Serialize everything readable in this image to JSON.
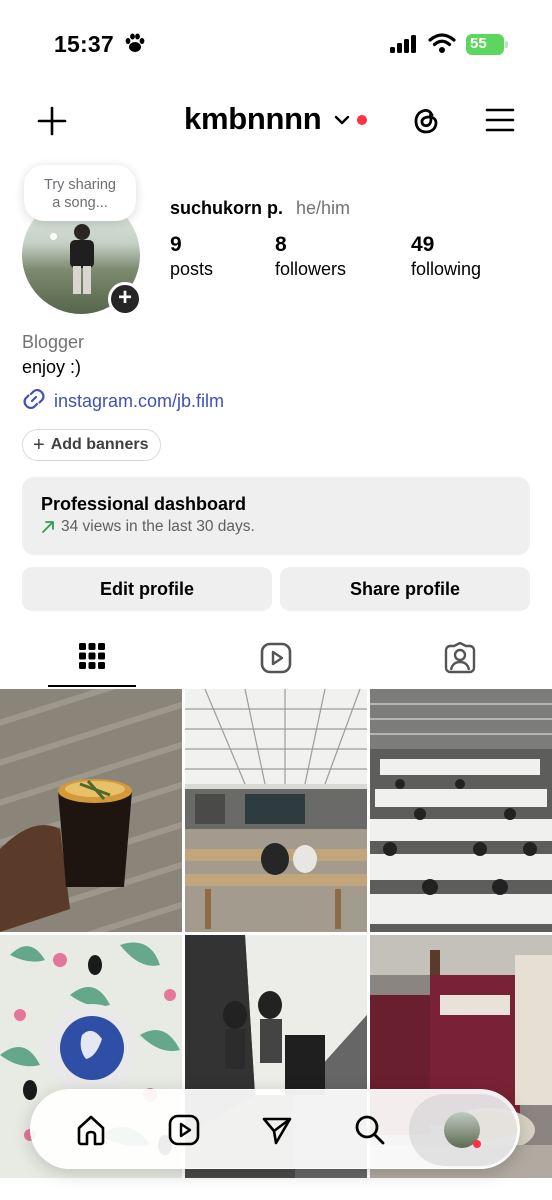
{
  "status_bar": {
    "time": "15:37",
    "battery": "55"
  },
  "header": {
    "username": "kmbnnnn"
  },
  "profile": {
    "bubble_text_line1": "Try sharing",
    "bubble_text_line2": "a song...",
    "name": "suchukorn p.",
    "pronouns": "he/him",
    "stats": [
      {
        "value": "9",
        "label": "posts"
      },
      {
        "value": "8",
        "label": "followers"
      },
      {
        "value": "49",
        "label": "following"
      }
    ],
    "category": "Blogger",
    "bio": "enjoy :)",
    "link": "instagram.com/jb.film",
    "add_banners": "Add banners"
  },
  "dashboard": {
    "title": "Professional dashboard",
    "subtitle": "34 views in the last 30 days."
  },
  "buttons": {
    "edit": "Edit profile",
    "share": "Share profile"
  },
  "tabs": [
    "grid-icon",
    "reels-icon",
    "tagged-icon"
  ],
  "nav": [
    "home-icon",
    "reels-icon",
    "send-icon",
    "search-icon",
    "profile-avatar"
  ],
  "colors": {
    "link": "#3f51b5",
    "notification": "#ff3040",
    "battery": "#5cd65c"
  }
}
